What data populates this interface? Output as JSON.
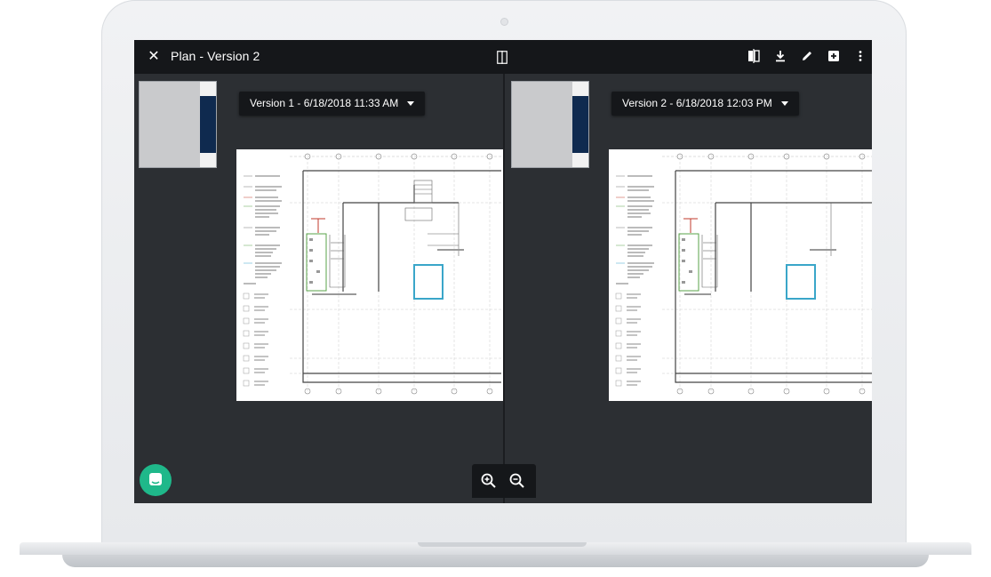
{
  "app": {
    "title": "Plan - Version 2"
  },
  "toolbar": {
    "icons": [
      "compare-icon",
      "download-icon",
      "edit-icon",
      "add-icon",
      "more-vert-icon"
    ]
  },
  "left_pane": {
    "version_label": "Version 1 - 6/18/2018 11:33 AM"
  },
  "right_pane": {
    "version_label": "Version 2 - 6/18/2018 12:03 PM"
  },
  "zoom": {
    "icons": [
      "zoom-in-icon",
      "zoom-out-icon"
    ]
  },
  "colors": {
    "topbar": "#15171a",
    "viewer_bg": "#2c2f33",
    "chat_button": "#1fb88a",
    "highlight_room": "#3aa6c9",
    "wall_red": "#c0392b",
    "wall_green": "#5aa34a"
  }
}
